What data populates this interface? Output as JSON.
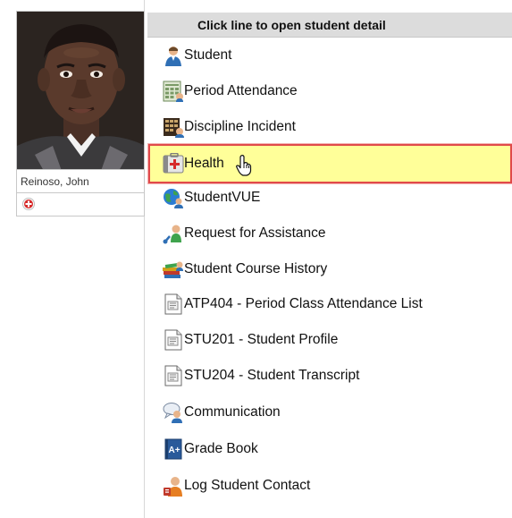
{
  "student": {
    "name": "Reinoso, John"
  },
  "menu": {
    "header": "Click line to open student detail",
    "items": [
      {
        "label": "Student",
        "icon": "student-icon"
      },
      {
        "label": "Period Attendance",
        "icon": "attendance-icon"
      },
      {
        "label": "Discipline Incident",
        "icon": "discipline-icon"
      },
      {
        "label": "Health",
        "icon": "health-kit-icon"
      },
      {
        "label": "StudentVUE",
        "icon": "globe-user-icon"
      },
      {
        "label": "Request for Assistance",
        "icon": "assistance-icon"
      },
      {
        "label": "Student Course History",
        "icon": "books-icon"
      },
      {
        "label": "ATP404 - Period Class Attendance List",
        "icon": "report-icon"
      },
      {
        "label": "STU201 - Student Profile",
        "icon": "report-icon"
      },
      {
        "label": "STU204 - Student Transcript",
        "icon": "report-icon"
      },
      {
        "label": "Communication",
        "icon": "communication-icon"
      },
      {
        "label": "Grade Book",
        "icon": "gradebook-icon"
      },
      {
        "label": "Log Student Contact",
        "icon": "contact-icon"
      }
    ],
    "highlighted_item": "Health"
  },
  "colors": {
    "header_bg": "#dcdcdc",
    "highlight_bg": "#ffff99",
    "highlight_border": "#e04a4a",
    "health_red": "#d62b2b"
  }
}
